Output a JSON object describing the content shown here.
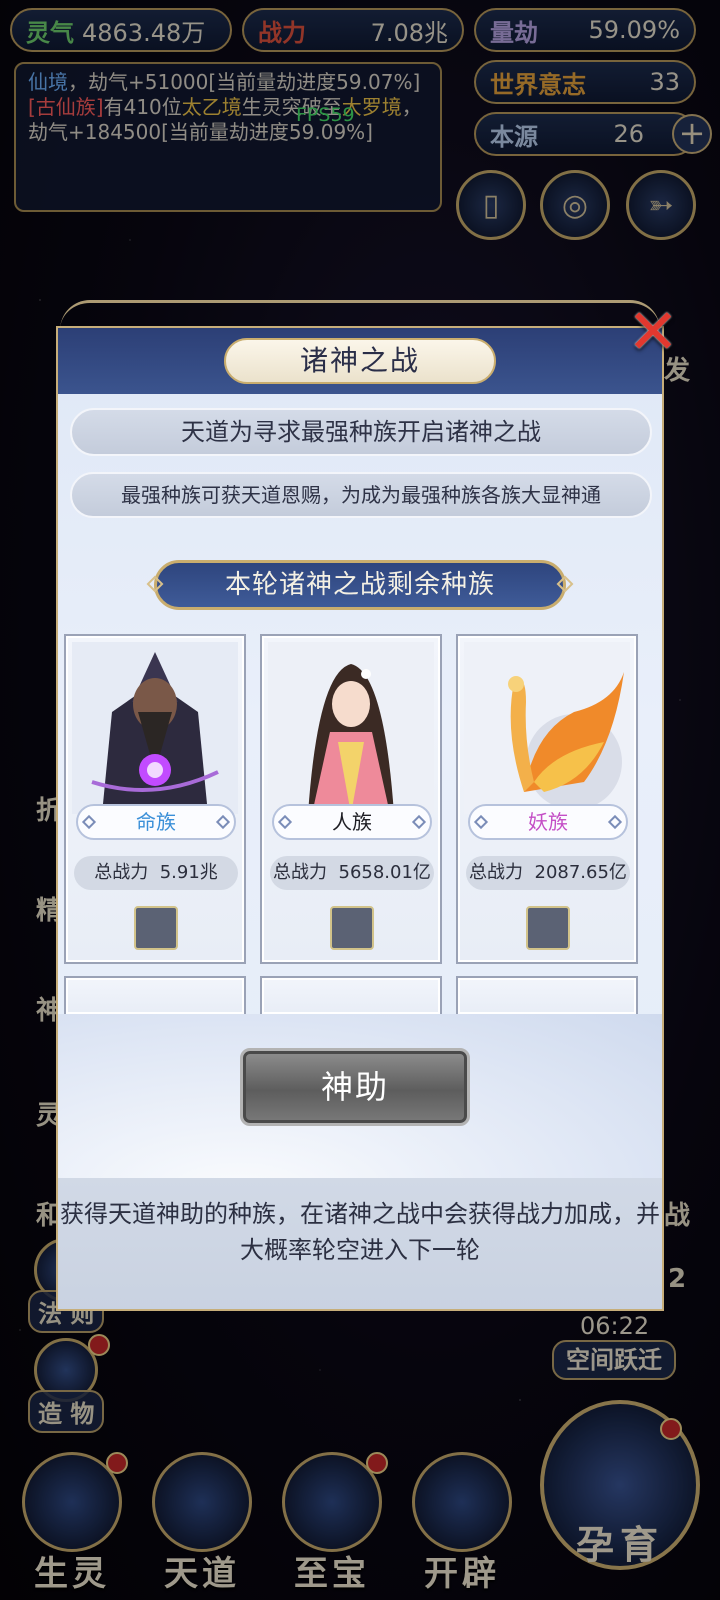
{
  "topbar": {
    "lingqi": {
      "label": "灵气",
      "value": "4863.48万"
    },
    "zhanli": {
      "label": "战力",
      "value": "7.08兆"
    },
    "liangjie": {
      "label": "量劫",
      "value": "59.09%"
    },
    "shijie": {
      "label": "世界意志",
      "value": "33"
    },
    "benyuan": {
      "label": "本源",
      "value": "26"
    },
    "plus": "+"
  },
  "fps": "FPS59",
  "log": {
    "line1_a": "仙境",
    "line1_b": "，劫气+51000[当前量劫进度59.07%]",
    "line2_a": "[古仙族]",
    "line2_b": "有410位",
    "line2_c": "太乙境",
    "line2_d": "生灵突破至",
    "line2_e": "大罗境",
    "line2_f": "，劫气+184500[当前量劫进度59.09%]"
  },
  "side": {
    "frag_fa": "发",
    "frag_zhe": "折",
    "frag_jing": "精",
    "frag_shen": "神",
    "frag_ling": "灵",
    "frag_he": "和",
    "frag_zhan": "战",
    "frag_two": "2",
    "fa_ze": "法 则",
    "zao_wu": "造 物",
    "timer": "06:22",
    "space_jump": "空间跃迁"
  },
  "bottom_nav": [
    "生灵",
    "天道",
    "至宝",
    "开辟"
  ],
  "big_button": "孕育",
  "modal": {
    "title": "诸神之战",
    "banner1": "天道为寻求最强种族开启诸神之战",
    "banner2": "最强种族可获天道恩赐，为成为最强种族各族大显神通",
    "subtitle": "本轮诸神之战剩余种族",
    "close": "✕",
    "cards": [
      {
        "name": "命族",
        "name_color": "#3a8fd8",
        "power_label": "总战力",
        "power": "5.91兆"
      },
      {
        "name": "人族",
        "name_color": "#1e1e24",
        "power_label": "总战力",
        "power": "5658.01亿"
      },
      {
        "name": "妖族",
        "name_color": "#c44fc6",
        "power_label": "总战力",
        "power": "2087.65亿"
      }
    ],
    "help_button": "神助",
    "description": "获得天道神助的种族，在诸神之战中会获得战力加成，并大概率轮空进入下一轮"
  }
}
